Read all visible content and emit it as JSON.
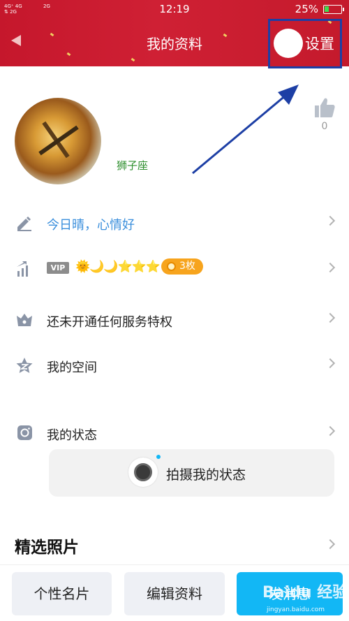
{
  "status_bar": {
    "signal_left": "4G⁺ 4G\n⇅ 2G",
    "signal_right": "2G",
    "time": "12:19",
    "battery_percent": "25%",
    "battery_level": 0.25,
    "battery_color": "#3ddc50"
  },
  "header": {
    "title": "我的资料",
    "settings_label": "设置",
    "background_color": "#c5172c",
    "highlight_color": "#1d3fa5"
  },
  "profile": {
    "constellation": "狮子座",
    "like_count": "0"
  },
  "rows": {
    "mood": "今日晴，心情好",
    "vip_tag": "VIP",
    "vip_level": "🌞🌙🌙⭐⭐⭐",
    "coin_badge": "3枚",
    "privilege": "还未开通任何服务特权",
    "space": "我的空间",
    "status": "我的状态"
  },
  "camera_card": {
    "label": "拍摄我的状态"
  },
  "photos": {
    "title": "精选照片"
  },
  "bottom_bar": {
    "card_button": "个性名片",
    "edit_button": "编辑资料",
    "message_button": "发消息",
    "accent_color": "#12b7f5"
  },
  "watermark": {
    "brand": "Baidu 经验",
    "url": "jingyan.baidu.com"
  }
}
